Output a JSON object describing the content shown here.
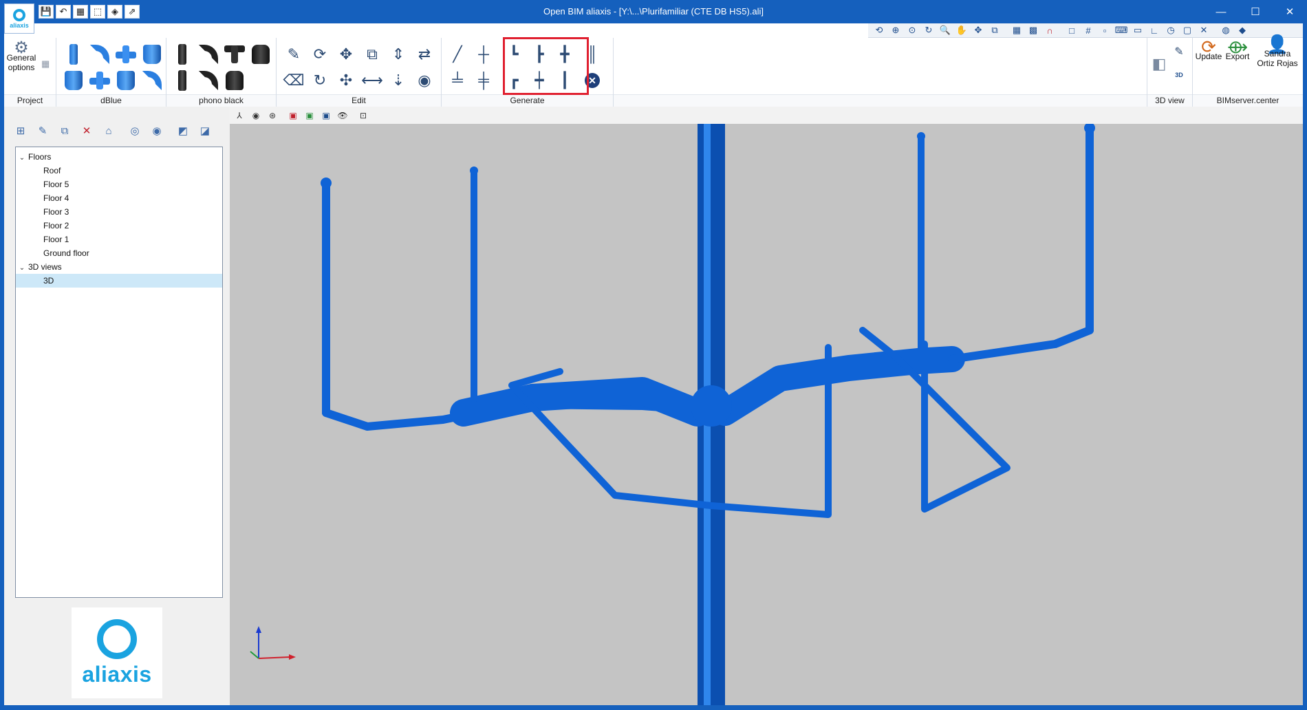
{
  "window": {
    "title": "Open BIM aliaxis - [Y:\\...\\Plurifamiliar (CTE DB HS5).ali]",
    "logo_text": "aliaxis",
    "controls": [
      "minimize-icon",
      "maximize-icon",
      "close-icon"
    ]
  },
  "quick_access": [
    "save-icon",
    "undo-icon",
    "project-icon",
    "import-icon",
    "package-icon",
    "export-arrow-icon"
  ],
  "view_toolbar_icons": [
    "rotate-view-icon",
    "zoom-extents-icon",
    "zoom-window-icon",
    "refresh-icon",
    "zoom-icon",
    "pan-icon",
    "orbit-icon",
    "fit-icon",
    "grid-icon",
    "layers-icon",
    "magnet-icon",
    "window-icon",
    "grid2-icon",
    "snap-icon",
    "keyboard-icon",
    "coords-icon",
    "angle-icon",
    "history-icon",
    "comment-icon",
    "tools-icon",
    "globe-icon",
    "settings-icon"
  ],
  "ribbon": {
    "project": {
      "label": "Project",
      "general_options_line1": "General",
      "general_options_line2": "options"
    },
    "dblue": {
      "label": "dBlue"
    },
    "phono_black": {
      "label": "phono black"
    },
    "edit": {
      "label": "Edit"
    },
    "generate": {
      "label": "Generate"
    },
    "view3d": {
      "label": "3D view",
      "view3d_badge": "3D"
    },
    "bimserver": {
      "label": "BIMserver.center",
      "update_label": "Update",
      "export_label": "Export",
      "user_line1": "Sandra",
      "user_line2": "Ortiz Rojas"
    }
  },
  "left_panel": {
    "tree": {
      "floors_label": "Floors",
      "floors": [
        "Roof",
        "Floor 5",
        "Floor 4",
        "Floor 3",
        "Floor 2",
        "Floor 1",
        "Ground floor"
      ],
      "views_label": "3D views",
      "views": [
        "3D"
      ]
    },
    "logo_text": "aliaxis"
  },
  "viewport": {
    "toolbar_icons": [
      "axes-icon",
      "camera-icon",
      "orbit-icon",
      "color-icon",
      "texture-icon",
      "box-icon",
      "eye-icon",
      "screenshot-icon"
    ],
    "pipe_color": "#0f63d6",
    "background_color": "#c4c4c4"
  }
}
